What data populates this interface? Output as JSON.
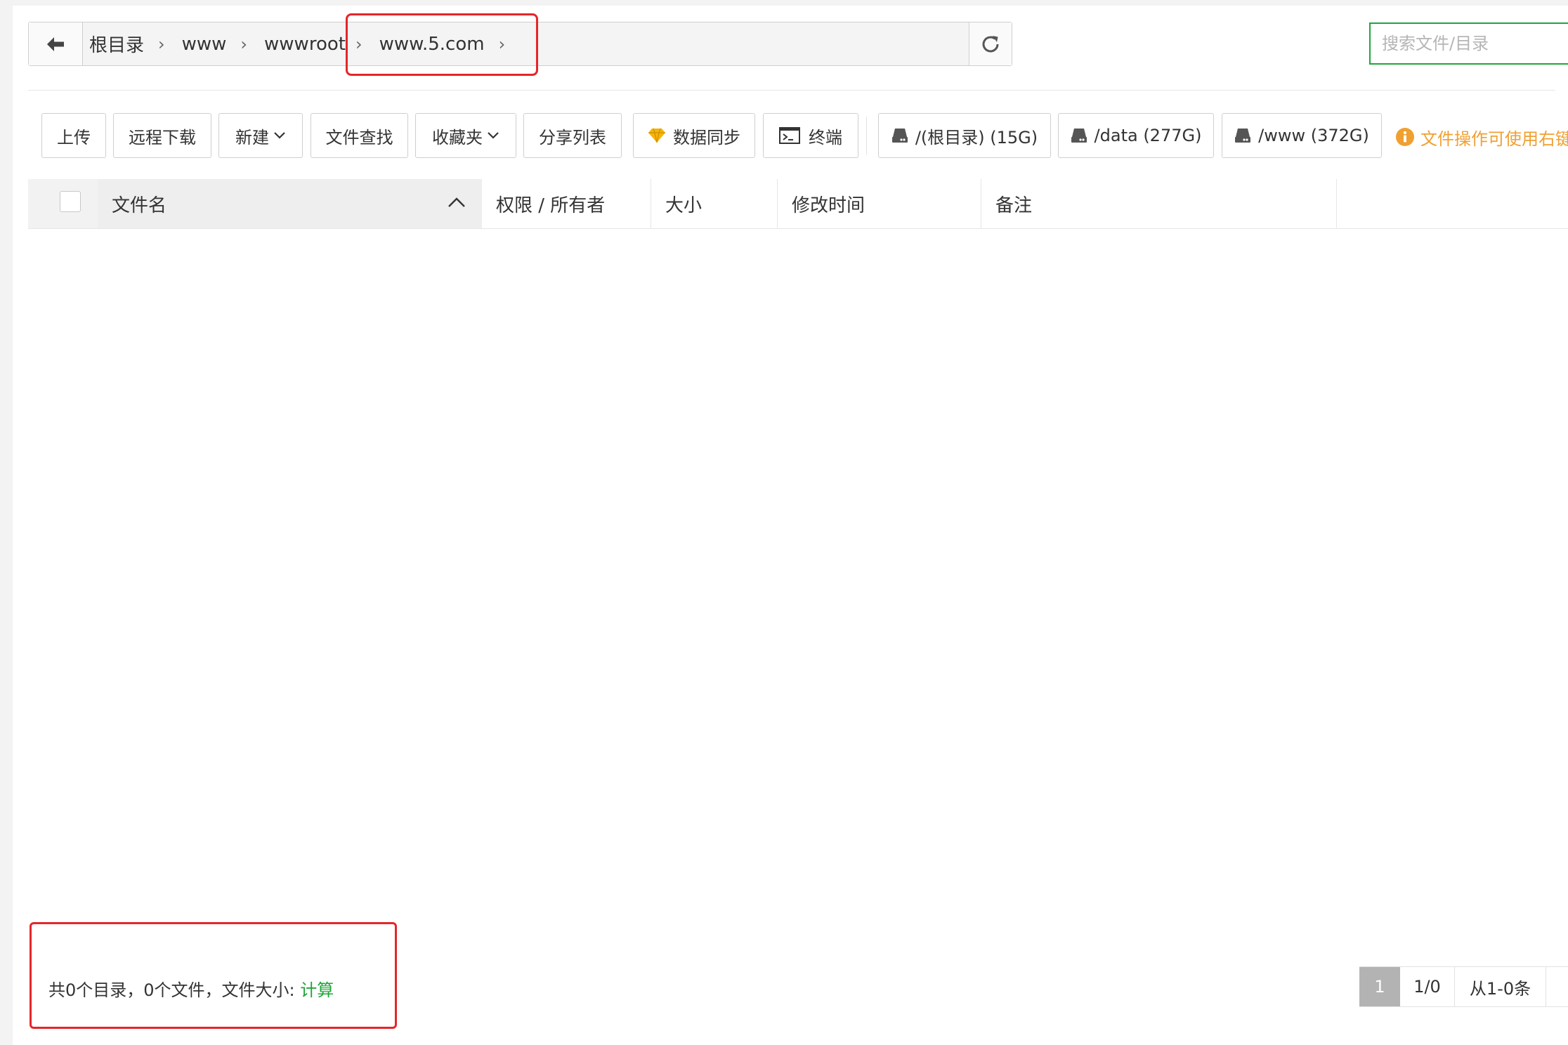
{
  "path_bar": {
    "breadcrumbs": [
      "根目录",
      "www",
      "wwwroot",
      "www.5.com"
    ],
    "search_placeholder": "搜索文件/目录"
  },
  "toolbar": {
    "upload": "上传",
    "remote_download": "远程下载",
    "new": "新建",
    "file_search": "文件查找",
    "favorites": "收藏夹",
    "share_list": "分享列表",
    "data_sync": "数据同步",
    "terminal": "终端",
    "disks": [
      "/(根目录) (15G)",
      "/data (277G)",
      "/www (372G)"
    ],
    "tip": "文件操作可使用右键"
  },
  "table": {
    "columns": {
      "name": "文件名",
      "permission": "权限 / 所有者",
      "size": "大小",
      "modified": "修改时间",
      "remark": "备注"
    }
  },
  "footer": {
    "summary": "共0个目录，0个文件，文件大小: ",
    "calculate": "计算",
    "pager": {
      "current_page": "1",
      "page_count": "1/0",
      "range": "从1-0条"
    }
  },
  "colors": {
    "accent_green": "#20a53a",
    "highlight_red": "#e5262a",
    "tip_orange": "#f0a030"
  }
}
